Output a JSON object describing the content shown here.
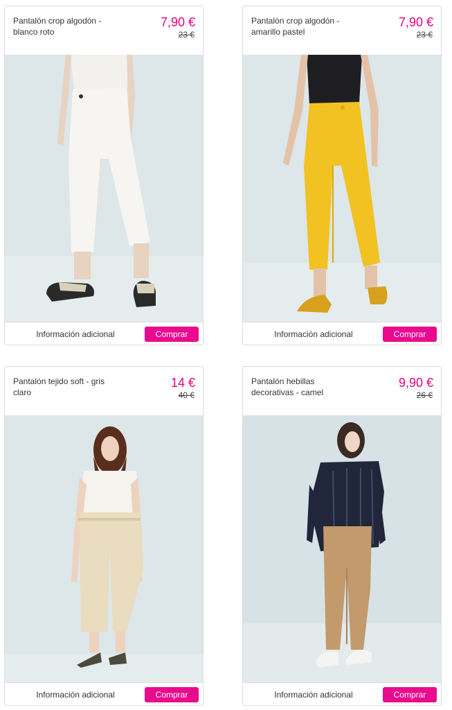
{
  "colors": {
    "price_accent": "#e5007e",
    "buy_button": "#ea0a8e",
    "card_border": "#dcdcdc",
    "photo_background": "#dde6e8"
  },
  "products": [
    {
      "title": "Pantalón crop algodón - blanco roto",
      "price": "7,90 €",
      "old_price": "23 €",
      "info_label": "Información adicional",
      "buy_label": "Comprar"
    },
    {
      "title": "Pantalón crop algodón - amarillo pastel",
      "price": "7,90 €",
      "old_price": "23 €",
      "info_label": "Información adicional",
      "buy_label": "Comprar"
    },
    {
      "title": "Pantalón tejido soft - gris claro",
      "price": "14 €",
      "old_price": "40 €",
      "info_label": "Información adicional",
      "buy_label": "Comprar"
    },
    {
      "title": "Pantalón hebillas decorativas - camel",
      "price": "9,90 €",
      "old_price": "26 €",
      "info_label": "Información adicional",
      "buy_label": "Comprar"
    }
  ]
}
